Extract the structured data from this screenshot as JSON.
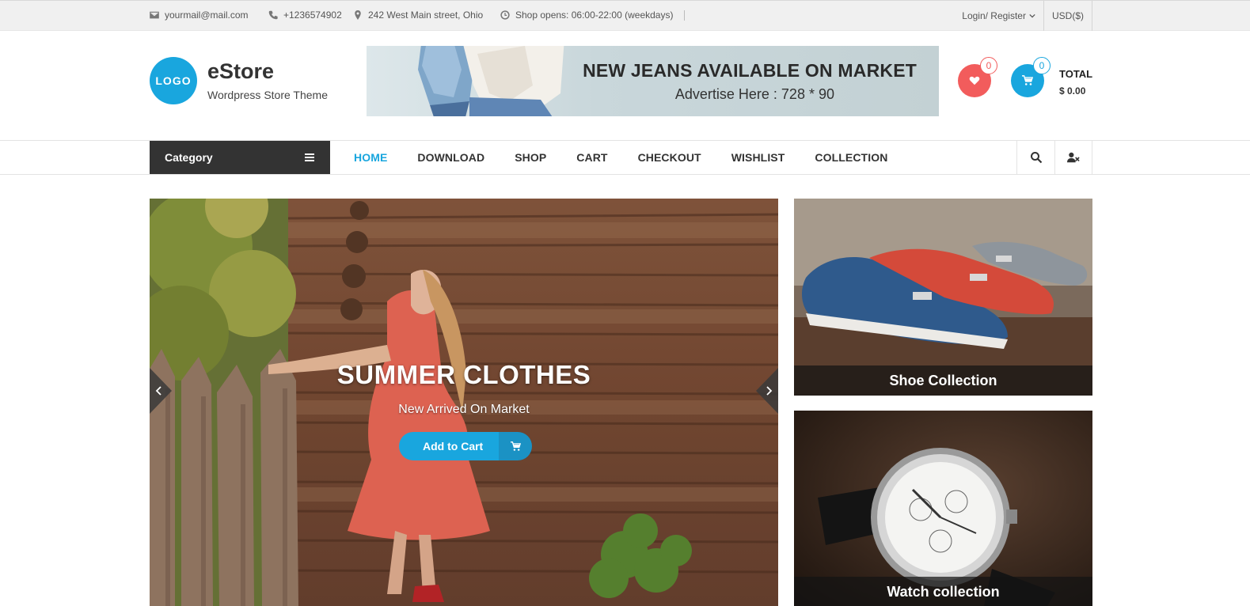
{
  "topbar": {
    "email": "yourmail@mail.com",
    "phone": "+1236574902",
    "address": "242 West Main street, Ohio",
    "hours": "Shop opens: 06:00-22:00 (weekdays)",
    "login_label": "Login/ Register",
    "currency": "USD($)"
  },
  "header": {
    "logo_text": "LOGO",
    "site_title": "eStore",
    "site_description": "Wordpress Store Theme",
    "ad_title": "NEW JEANS AVAILABLE ON MARKET",
    "ad_subtitle": "Advertise Here : 728 * 90",
    "wishlist_count": "0",
    "cart_count": "0",
    "total_label": "TOTAL",
    "total_value": "$ 0.00"
  },
  "nav": {
    "category_label": "Category",
    "items": [
      {
        "label": "HOME",
        "active": true
      },
      {
        "label": "DOWNLOAD"
      },
      {
        "label": "SHOP"
      },
      {
        "label": "CART"
      },
      {
        "label": "CHECKOUT"
      },
      {
        "label": "WISHLIST"
      },
      {
        "label": "COLLECTION"
      }
    ]
  },
  "slider": {
    "title": "SUMMER CLOTHES",
    "subtitle": "New Arrived On Market",
    "button_label": "Add to Cart"
  },
  "promos": {
    "shoe_caption": "Shoe Collection",
    "watch_caption": "Watch collection"
  },
  "colors": {
    "accent": "#19a6de",
    "wishlist": "#f25c5c",
    "dark": "#333333"
  },
  "icons": [
    "envelope-icon",
    "phone-icon",
    "map-marker-icon",
    "clock-icon",
    "chevron-down-icon",
    "heart-icon",
    "cart-icon",
    "menu-icon",
    "search-icon",
    "user-icon",
    "chevron-left-icon",
    "chevron-right-icon"
  ]
}
